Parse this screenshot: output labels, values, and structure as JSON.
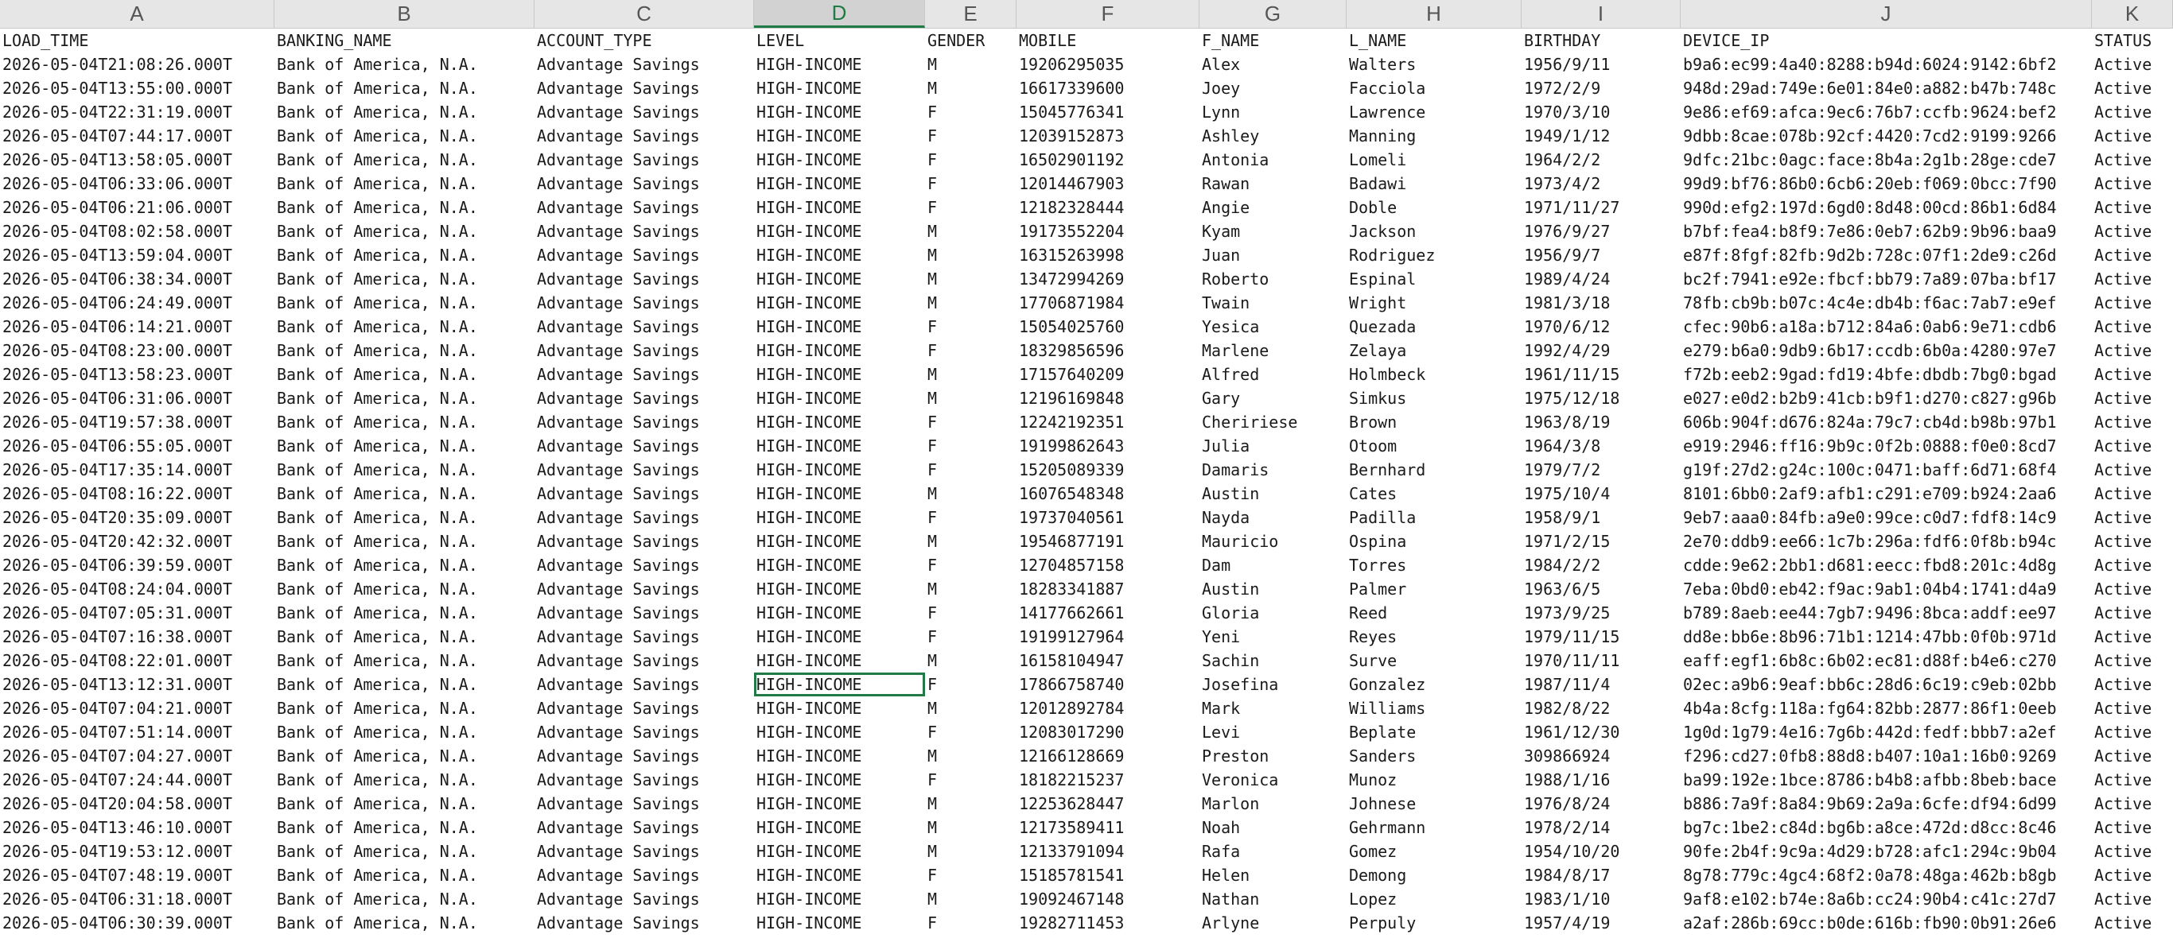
{
  "sheet": {
    "column_letters": [
      "A",
      "B",
      "C",
      "D",
      "E",
      "F",
      "G",
      "H",
      "I",
      "J",
      "K"
    ],
    "selected_column": "D",
    "active_cell": {
      "row": 27,
      "col": 3
    },
    "colors": {
      "grid_accent": "#1f7a45",
      "header_bg": "#e6e6e6"
    }
  },
  "headers": [
    "LOAD_TIME",
    "BANKING_NAME",
    "ACCOUNT_TYPE",
    "LEVEL",
    "GENDER",
    "MOBILE",
    "F_NAME",
    "L_NAME",
    "BIRTHDAY",
    "DEVICE_IP",
    "STATUS"
  ],
  "rows": [
    [
      "2026-05-04T21:08:26.000T",
      "Bank of America, N.A.",
      "Advantage Savings",
      "HIGH-INCOME",
      "M",
      "19206295035",
      "Alex",
      "Walters",
      "1956/9/11",
      "b9a6:ec99:4a40:8288:b94d:6024:9142:6bf2",
      "Active"
    ],
    [
      "2026-05-04T13:55:00.000T",
      "Bank of America, N.A.",
      "Advantage Savings",
      "HIGH-INCOME",
      "M",
      "16617339600",
      "Joey",
      "Facciola",
      "1972/2/9",
      "948d:29ad:749e:6e01:84e0:a882:b47b:748c",
      "Active"
    ],
    [
      "2026-05-04T22:31:19.000T",
      "Bank of America, N.A.",
      "Advantage Savings",
      "HIGH-INCOME",
      "F",
      "15045776341",
      "Lynn",
      "Lawrence",
      "1970/3/10",
      "9e86:ef69:afca:9ec6:76b7:ccfb:9624:bef2",
      "Active"
    ],
    [
      "2026-05-04T07:44:17.000T",
      "Bank of America, N.A.",
      "Advantage Savings",
      "HIGH-INCOME",
      "F",
      "12039152873",
      "Ashley",
      "Manning",
      "1949/1/12",
      "9dbb:8cae:078b:92cf:4420:7cd2:9199:9266",
      "Active"
    ],
    [
      "2026-05-04T13:58:05.000T",
      "Bank of America, N.A.",
      "Advantage Savings",
      "HIGH-INCOME",
      "F",
      "16502901192",
      "Antonia",
      "Lomeli",
      "1964/2/2",
      "9dfc:21bc:0agc:face:8b4a:2g1b:28ge:cde7",
      "Active"
    ],
    [
      "2026-05-04T06:33:06.000T",
      "Bank of America, N.A.",
      "Advantage Savings",
      "HIGH-INCOME",
      "F",
      "12014467903",
      "Rawan",
      "Badawi",
      "1973/4/2",
      "99d9:bf76:86b0:6cb6:20eb:f069:0bcc:7f90",
      "Active"
    ],
    [
      "2026-05-04T06:21:06.000T",
      "Bank of America, N.A.",
      "Advantage Savings",
      "HIGH-INCOME",
      "F",
      "12182328444",
      "Angie",
      "Doble",
      "1971/11/27",
      "990d:efg2:197d:6gd0:8d48:00cd:86b1:6d84",
      "Active"
    ],
    [
      "2026-05-04T08:02:58.000T",
      "Bank of America, N.A.",
      "Advantage Savings",
      "HIGH-INCOME",
      "M",
      "19173552204",
      "Kyam",
      "Jackson",
      "1976/9/27",
      "b7bf:fea4:b8f9:7e86:0eb7:62b9:9b96:baa9",
      "Active"
    ],
    [
      "2026-05-04T13:59:04.000T",
      "Bank of America, N.A.",
      "Advantage Savings",
      "HIGH-INCOME",
      "M",
      "16315263998",
      "Juan",
      "Rodriguez",
      "1956/9/7",
      "e87f:8fgf:82fb:9d2b:728c:07f1:2de9:c26d",
      "Active"
    ],
    [
      "2026-05-04T06:38:34.000T",
      "Bank of America, N.A.",
      "Advantage Savings",
      "HIGH-INCOME",
      "M",
      "13472994269",
      "Roberto",
      "Espinal",
      "1989/4/24",
      "bc2f:7941:e92e:fbcf:bb79:7a89:07ba:bf17",
      "Active"
    ],
    [
      "2026-05-04T06:24:49.000T",
      "Bank of America, N.A.",
      "Advantage Savings",
      "HIGH-INCOME",
      "M",
      "17706871984",
      "Twain",
      "Wright",
      "1981/3/18",
      "78fb:cb9b:b07c:4c4e:db4b:f6ac:7ab7:e9ef",
      "Active"
    ],
    [
      "2026-05-04T06:14:21.000T",
      "Bank of America, N.A.",
      "Advantage Savings",
      "HIGH-INCOME",
      "F",
      "15054025760",
      "Yesica",
      "Quezada",
      "1970/6/12",
      "cfec:90b6:a18a:b712:84a6:0ab6:9e71:cdb6",
      "Active"
    ],
    [
      "2026-05-04T08:23:00.000T",
      "Bank of America, N.A.",
      "Advantage Savings",
      "HIGH-INCOME",
      "F",
      "18329856596",
      "Marlene",
      "Zelaya",
      "1992/4/29",
      "e279:b6a0:9db9:6b17:ccdb:6b0a:4280:97e7",
      "Active"
    ],
    [
      "2026-05-04T13:58:23.000T",
      "Bank of America, N.A.",
      "Advantage Savings",
      "HIGH-INCOME",
      "M",
      "17157640209",
      "Alfred",
      "Holmbeck",
      "1961/11/15",
      "f72b:eeb2:9gad:fd19:4bfe:dbdb:7bg0:bgad",
      "Active"
    ],
    [
      "2026-05-04T06:31:06.000T",
      "Bank of America, N.A.",
      "Advantage Savings",
      "HIGH-INCOME",
      "M",
      "12196169848",
      "Gary",
      "Simkus",
      "1975/12/18",
      "e027:e0d2:b2b9:41cb:b9f1:d270:c827:g96b",
      "Active"
    ],
    [
      "2026-05-04T19:57:38.000T",
      "Bank of America, N.A.",
      "Advantage Savings",
      "HIGH-INCOME",
      "F",
      "12242192351",
      "Cheririese",
      "Brown",
      "1963/8/19",
      "606b:904f:d676:824a:79c7:cb4d:b98b:97b1",
      "Active"
    ],
    [
      "2026-05-04T06:55:05.000T",
      "Bank of America, N.A.",
      "Advantage Savings",
      "HIGH-INCOME",
      "F",
      "19199862643",
      "Julia",
      "Otoom",
      "1964/3/8",
      "e919:2946:ff16:9b9c:0f2b:0888:f0e0:8cd7",
      "Active"
    ],
    [
      "2026-05-04T17:35:14.000T",
      "Bank of America, N.A.",
      "Advantage Savings",
      "HIGH-INCOME",
      "F",
      "15205089339",
      "Damaris",
      "Bernhard",
      "1979/7/2",
      "g19f:27d2:g24c:100c:0471:baff:6d71:68f4",
      "Active"
    ],
    [
      "2026-05-04T08:16:22.000T",
      "Bank of America, N.A.",
      "Advantage Savings",
      "HIGH-INCOME",
      "M",
      "16076548348",
      "Austin",
      "Cates",
      "1975/10/4",
      "8101:6bb0:2af9:afb1:c291:e709:b924:2aa6",
      "Active"
    ],
    [
      "2026-05-04T20:35:09.000T",
      "Bank of America, N.A.",
      "Advantage Savings",
      "HIGH-INCOME",
      "F",
      "19737040561",
      "Nayda",
      "Padilla",
      "1958/9/1",
      "9eb7:aaa0:84fb:a9e0:99ce:c0d7:fdf8:14c9",
      "Active"
    ],
    [
      "2026-05-04T20:42:32.000T",
      "Bank of America, N.A.",
      "Advantage Savings",
      "HIGH-INCOME",
      "M",
      "19546877191",
      "Mauricio",
      "Ospina",
      "1971/2/15",
      "2e70:ddb9:ee66:1c7b:296a:fdf6:0f8b:b94c",
      "Active"
    ],
    [
      "2026-05-04T06:39:59.000T",
      "Bank of America, N.A.",
      "Advantage Savings",
      "HIGH-INCOME",
      "F",
      "12704857158",
      "Dam",
      "Torres",
      "1984/2/2",
      "cdde:9e62:2bb1:d681:eecc:fbd8:201c:4d8g",
      "Active"
    ],
    [
      "2026-05-04T08:24:04.000T",
      "Bank of America, N.A.",
      "Advantage Savings",
      "HIGH-INCOME",
      "M",
      "18283341887",
      "Austin",
      "Palmer",
      "1963/6/5",
      "7eba:0bd0:eb42:f9ac:9ab1:04b4:1741:d4a9",
      "Active"
    ],
    [
      "2026-05-04T07:05:31.000T",
      "Bank of America, N.A.",
      "Advantage Savings",
      "HIGH-INCOME",
      "F",
      "14177662661",
      "Gloria",
      "Reed",
      "1973/9/25",
      "b789:8aeb:ee44:7gb7:9496:8bca:addf:ee97",
      "Active"
    ],
    [
      "2026-05-04T07:16:38.000T",
      "Bank of America, N.A.",
      "Advantage Savings",
      "HIGH-INCOME",
      "F",
      "19199127964",
      "Yeni",
      "Reyes",
      "1979/11/15",
      "dd8e:bb6e:8b96:71b1:1214:47bb:0f0b:971d",
      "Active"
    ],
    [
      "2026-05-04T08:22:01.000T",
      "Bank of America, N.A.",
      "Advantage Savings",
      "HIGH-INCOME",
      "M",
      "16158104947",
      "Sachin",
      "Surve",
      "1970/11/11",
      "eaff:egf1:6b8c:6b02:ec81:d88f:b4e6:c270",
      "Active"
    ],
    [
      "2026-05-04T13:12:31.000T",
      "Bank of America, N.A.",
      "Advantage Savings",
      "HIGH-INCOME",
      "F",
      "17866758740",
      "Josefina",
      "Gonzalez",
      "1987/11/4",
      "02ec:a9b6:9eaf:bb6c:28d6:6c19:c9eb:02bb",
      "Active"
    ],
    [
      "2026-05-04T07:04:21.000T",
      "Bank of America, N.A.",
      "Advantage Savings",
      "HIGH-INCOME",
      "M",
      "12012892784",
      "Mark",
      "Williams",
      "1982/8/22",
      "4b4a:8cfg:118a:fg64:82bb:2877:86f1:0eeb",
      "Active"
    ],
    [
      "2026-05-04T07:51:14.000T",
      "Bank of America, N.A.",
      "Advantage Savings",
      "HIGH-INCOME",
      "F",
      "12083017290",
      "Levi",
      "Beplate",
      "1961/12/30",
      "1g0d:1g79:4e16:7g6b:442d:fedf:bbb7:a2ef",
      "Active"
    ],
    [
      "2026-05-04T07:04:27.000T",
      "Bank of America, N.A.",
      "Advantage Savings",
      "HIGH-INCOME",
      "M",
      "12166128669",
      "Preston",
      "Sanders",
      "309866924",
      "f296:cd27:0fb8:88d8:b407:10a1:16b0:9269",
      "Active"
    ],
    [
      "2026-05-04T07:24:44.000T",
      "Bank of America, N.A.",
      "Advantage Savings",
      "HIGH-INCOME",
      "F",
      "18182215237",
      "Veronica",
      "Munoz",
      "1988/1/16",
      "ba99:192e:1bce:8786:b4b8:afbb:8beb:bace",
      "Active"
    ],
    [
      "2026-05-04T20:04:58.000T",
      "Bank of America, N.A.",
      "Advantage Savings",
      "HIGH-INCOME",
      "M",
      "12253628447",
      "Marlon",
      "Johnese",
      "1976/8/24",
      "b886:7a9f:8a84:9b69:2a9a:6cfe:df94:6d99",
      "Active"
    ],
    [
      "2026-05-04T13:46:10.000T",
      "Bank of America, N.A.",
      "Advantage Savings",
      "HIGH-INCOME",
      "M",
      "12173589411",
      "Noah",
      "Gehrmann",
      "1978/2/14",
      "bg7c:1be2:c84d:bg6b:a8ce:472d:d8cc:8c46",
      "Active"
    ],
    [
      "2026-05-04T19:53:12.000T",
      "Bank of America, N.A.",
      "Advantage Savings",
      "HIGH-INCOME",
      "M",
      "12133791094",
      "Rafa",
      "Gomez",
      "1954/10/20",
      "90fe:2b4f:9c9a:4d29:b728:afc1:294c:9b04",
      "Active"
    ],
    [
      "2026-05-04T07:48:19.000T",
      "Bank of America, N.A.",
      "Advantage Savings",
      "HIGH-INCOME",
      "F",
      "15185781541",
      "Helen",
      "Demong",
      "1984/8/17",
      "8g78:779c:4gc4:68f2:0a78:48ga:462b:b8gb",
      "Active"
    ],
    [
      "2026-05-04T06:31:18.000T",
      "Bank of America, N.A.",
      "Advantage Savings",
      "HIGH-INCOME",
      "M",
      "19092467148",
      "Nathan",
      "Lopez",
      "1983/1/10",
      "9af8:e102:b74e:8a6b:cc24:90b4:c41c:27d7",
      "Active"
    ],
    [
      "2026-05-04T06:30:39.000T",
      "Bank of America, N.A.",
      "Advantage Savings",
      "HIGH-INCOME",
      "F",
      "19282711453",
      "Arlyne",
      "Perpuly",
      "1957/4/19",
      "a2af:286b:69cc:b0de:616b:fb90:0b91:26e6",
      "Active"
    ]
  ]
}
